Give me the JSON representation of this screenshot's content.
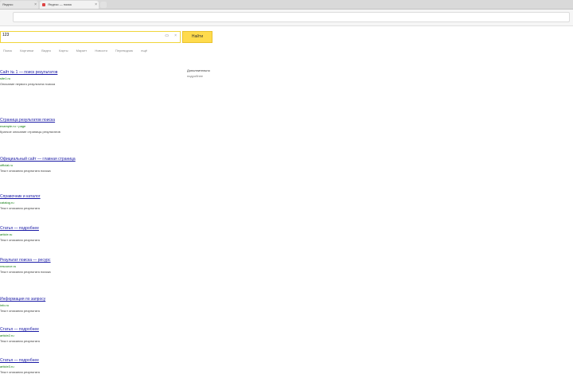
{
  "browser": {
    "tabs": [
      {
        "label": "Яндекс"
      },
      {
        "label": "Яндекс — поиск"
      }
    ]
  },
  "search": {
    "query": "123",
    "button_label": "Найти",
    "tabs": [
      "Поиск",
      "Картинки",
      "Видео",
      "Карты",
      "Маркет",
      "Новости",
      "Переводчик",
      "ещё"
    ]
  },
  "results": [
    {
      "title": "Сайт № 1 — поиск результатов",
      "url": "site1.ru",
      "snippet": "Описание первого результата поиска"
    },
    {
      "title": "Страница результатов поиска",
      "url": "example.ru › page",
      "snippet": "Краткое описание страницы результатов"
    },
    {
      "title": "Официальный сайт — главная страница",
      "url": "official.ru",
      "snippet": "Текст описания результата поиска"
    },
    {
      "title": "Справочник и каталог",
      "url": "catalog.ru",
      "snippet": "Текст описания результата"
    },
    {
      "title": "Статья — подробнее",
      "url": "article.ru",
      "snippet": "Текст описания результата"
    },
    {
      "title": "Результат поиска — ресурс",
      "url": "resource.ru",
      "snippet": "Текст описания результата поиска"
    },
    {
      "title": "Информация по запросу",
      "url": "info.ru",
      "snippet": "Текст описания результата"
    },
    {
      "title": "Статья — подробнее",
      "url": "article2.ru",
      "snippet": "Текст описания результата"
    },
    {
      "title": "Статья — подробнее",
      "url": "article3.ru",
      "snippet": "Текст описания результата"
    }
  ],
  "side": {
    "title": "Дополнительно",
    "sub": "подробнее"
  }
}
